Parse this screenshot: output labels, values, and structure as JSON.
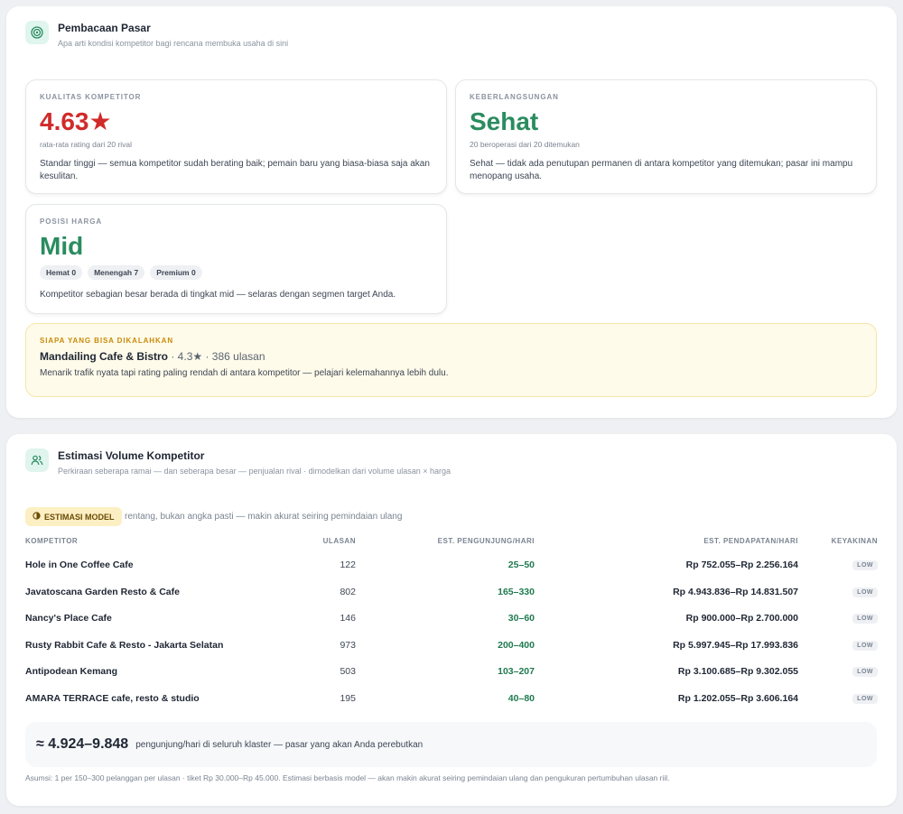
{
  "market_reading": {
    "title": "Pembacaan Pasar",
    "subtitle": "Apa arti kondisi kompetitor bagi rencana membuka usaha di sini",
    "icon": "target-icon",
    "quality": {
      "label": "KUALITAS KOMPETITOR",
      "value": "4.63★",
      "sub": "rata-rata rating dari 20 rival",
      "desc": "Standar tinggi — semua kompetitor sudah berating baik; pemain baru yang biasa-biasa saja akan kesulitan."
    },
    "survival": {
      "label": "KEBERLANGSUNGAN",
      "value": "Sehat",
      "sub": "20 beroperasi dari 20 ditemukan",
      "desc": "Sehat — tidak ada penutupan permanen di antara kompetitor yang ditemukan; pasar ini mampu menopang usaha."
    },
    "price": {
      "label": "POSISI HARGA",
      "value": "Mid",
      "chips": [
        "Hemat 0",
        "Menengah 7",
        "Premium 0"
      ],
      "desc": "Kompetitor sebagian besar berada di tingkat mid — selaras dengan segmen target Anda."
    },
    "beatable": {
      "label": "SIAPA YANG BISA DIKALAHKAN",
      "name": "Mandailing Cafe & Bistro",
      "meta": " · 4.3★ · 386 ulasan",
      "desc": "Menarik trafik nyata tapi rating paling rendah di antara kompetitor — pelajari kelemahannya lebih dulu."
    }
  },
  "volume": {
    "title": "Estimasi Volume Kompetitor",
    "subtitle": "Perkiraan seberapa ramai — dan seberapa besar — penjualan rival · dimodelkan dari volume ulasan × harga",
    "icon": "users-icon",
    "badge": "ESTIMASI MODEL",
    "badge_icon": "half-circle-icon",
    "badge_note": "rentang, bukan angka pasti — makin akurat seiring pemindaian ulang",
    "columns": {
      "competitor": "KOMPETITOR",
      "reviews": "ULASAN",
      "visitors": "EST. PENGUNJUNG/HARI",
      "revenue": "EST. PENDAPATAN/HARI",
      "confidence": "KEYAKINAN"
    },
    "rows": [
      {
        "name": "Hole in One Coffee Cafe",
        "reviews": "122",
        "visitors": "25–50",
        "revenue": "Rp 752.055–Rp 2.256.164",
        "confidence": "LOW"
      },
      {
        "name": "Javatoscana Garden Resto & Cafe",
        "reviews": "802",
        "visitors": "165–330",
        "revenue": "Rp 4.943.836–Rp 14.831.507",
        "confidence": "LOW"
      },
      {
        "name": "Nancy's Place Cafe",
        "reviews": "146",
        "visitors": "30–60",
        "revenue": "Rp 900.000–Rp 2.700.000",
        "confidence": "LOW"
      },
      {
        "name": "Rusty Rabbit Cafe & Resto - Jakarta Selatan",
        "reviews": "973",
        "visitors": "200–400",
        "revenue": "Rp 5.997.945–Rp 17.993.836",
        "confidence": "LOW"
      },
      {
        "name": "Antipodean Kemang",
        "reviews": "503",
        "visitors": "103–207",
        "revenue": "Rp 3.100.685–Rp 9.302.055",
        "confidence": "LOW"
      },
      {
        "name": "AMARA TERRACE cafe, resto & studio",
        "reviews": "195",
        "visitors": "40–80",
        "revenue": "Rp 1.202.055–Rp 3.606.164",
        "confidence": "LOW"
      }
    ],
    "total_value": "≈ 4.924–9.848",
    "total_note": "pengunjung/hari di seluruh klaster — pasar yang akan Anda perebutkan",
    "assumption": "Asumsi: 1 per 150–300 pelanggan per ulasan · tiket Rp 30.000–Rp 45.000. Estimasi berbasis model — akan makin akurat seiring pemindaian ulang dan pengukuran pertumbuhan ulasan riil."
  }
}
